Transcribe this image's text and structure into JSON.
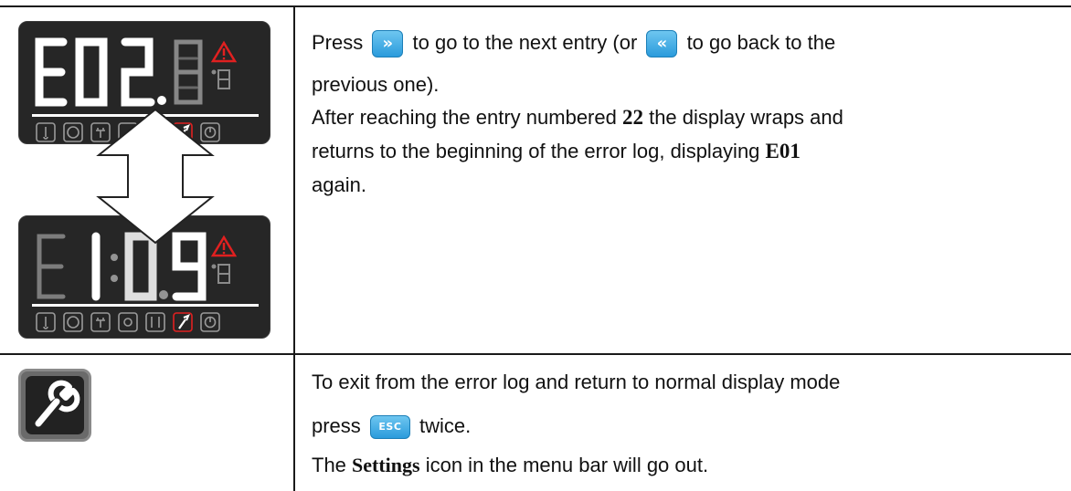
{
  "top_cell": {
    "panels": [
      {
        "display": "E02.8",
        "aux_digit": "8",
        "active_icon": "wrench-icon"
      },
      {
        "display": "E1:09",
        "aux_digit": "8",
        "active_icon": "wrench-icon"
      }
    ],
    "text": {
      "l1_a": "Press",
      "next_key": "»",
      "l1_b": "to go to the next entry (or",
      "prev_key": "«",
      "l1_c": "to go back to the",
      "l2": "previous one).",
      "l3_a": "After reaching the entry numbered ",
      "l3_num": "22",
      "l3_b": " the display wraps and",
      "l4_a": "returns to the beginning of the error log, displaying ",
      "l4_code": "E01",
      "l5": "again."
    }
  },
  "bottom_cell": {
    "icon": "wrench-icon",
    "text": {
      "l1": "To exit from the error log and return to normal display mode",
      "l2_a": "press",
      "esc_key": "ESC",
      "l2_b": "twice.",
      "l3_a": "The ",
      "l3_b": "Settings",
      "l3_c": " icon in the menu bar will go out."
    }
  },
  "colors": {
    "panel_bg": "#262626",
    "segment_on": "#ffffff",
    "segment_dim": "#4a4a4a",
    "warning": "#e02020",
    "key_blue": "#2a9bdc"
  }
}
